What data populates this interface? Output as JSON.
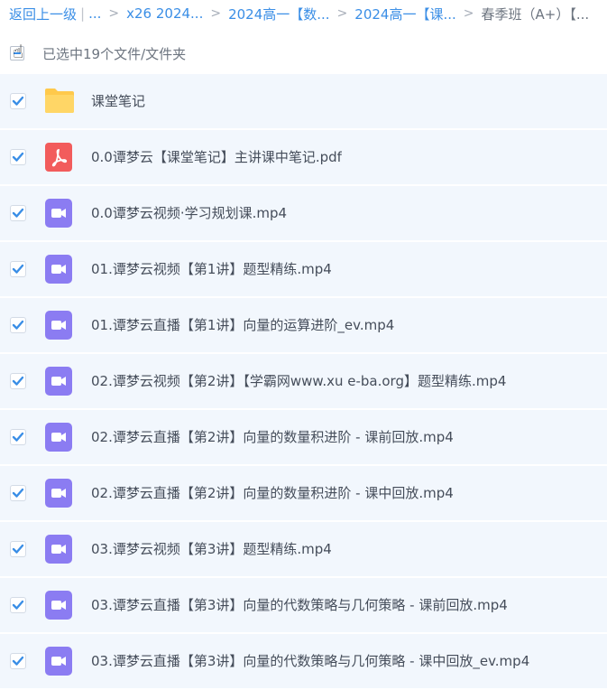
{
  "breadcrumb": {
    "back": "返回上一级",
    "ellipsis": "...",
    "crumbs": [
      "x26 2024...",
      "2024高一【数...",
      "2024高一【课..."
    ],
    "current": "春季班（A+）【..."
  },
  "selection": {
    "summary": "已选中19个文件/文件夹"
  },
  "files": [
    {
      "name": "课堂笔记",
      "type": "folder",
      "checked": true
    },
    {
      "name": "0.0谭梦云【课堂笔记】主讲课中笔记.pdf",
      "type": "pdf",
      "checked": true
    },
    {
      "name": "0.0谭梦云视频·学习规划课.mp4",
      "type": "video",
      "checked": true
    },
    {
      "name": "01.谭梦云视频【第1讲】题型精练.mp4",
      "type": "video",
      "checked": true
    },
    {
      "name": "01.谭梦云直播【第1讲】向量的运算进阶_ev.mp4",
      "type": "video",
      "checked": true
    },
    {
      "name": "02.谭梦云视频【第2讲】【学霸网www.xu e-ba.org】题型精练.mp4",
      "type": "video",
      "checked": true
    },
    {
      "name": "02.谭梦云直播【第2讲】向量的数量积进阶 - 课前回放.mp4",
      "type": "video",
      "checked": true
    },
    {
      "name": "02.谭梦云直播【第2讲】向量的数量积进阶 - 课中回放.mp4",
      "type": "video",
      "checked": true
    },
    {
      "name": "03.谭梦云视频【第3讲】题型精练.mp4",
      "type": "video",
      "checked": true
    },
    {
      "name": "03.谭梦云直播【第3讲】向量的代数策略与几何策略 - 课前回放.mp4",
      "type": "video",
      "checked": true
    },
    {
      "name": "03.谭梦云直播【第3讲】向量的代数策略与几何策略 - 课中回放_ev.mp4",
      "type": "video",
      "checked": true
    }
  ],
  "colors": {
    "link": "#3a8ee6",
    "check": "#3a8ee6",
    "row_bg": "#f2f7fd",
    "folder": "#ffc94b",
    "pdf": "#f25c5c",
    "video": "#8b7cf2"
  }
}
